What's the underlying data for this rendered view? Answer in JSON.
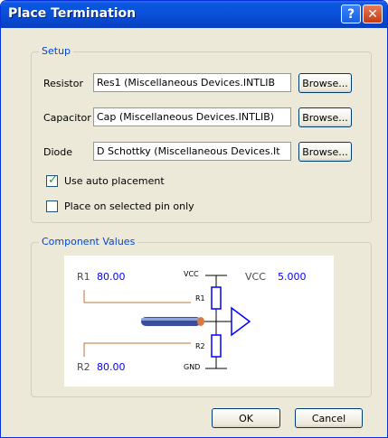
{
  "window": {
    "title": "Place Termination",
    "help_glyph": "?",
    "close_glyph": "✕"
  },
  "setup": {
    "group_label": "Setup",
    "resistor": {
      "label": "Resistor",
      "value": "Res1 (Miscellaneous Devices.INTLIB"
    },
    "capacitor": {
      "label": "Capacitor",
      "value": "Cap (Miscellaneous Devices.INTLIB)"
    },
    "diode": {
      "label": "Diode",
      "value": "D Schottky (Miscellaneous Devices.It"
    },
    "browse_label": "Browse...",
    "auto_placement": {
      "label": "Use auto placement",
      "checked": true
    },
    "selected_pin": {
      "label": "Place on selected pin only",
      "checked": false
    }
  },
  "component_values": {
    "group_label": "Component Values",
    "r1_label": "R1",
    "r1_value": "80.00",
    "r2_label": "R2",
    "r2_value": "80.00",
    "vcc_label": "VCC",
    "vcc_value": "5.000",
    "schematic": {
      "vcc": "VCC",
      "gnd": "GND",
      "r1": "R1",
      "r2": "R2"
    }
  },
  "buttons": {
    "ok": "OK",
    "cancel": "Cancel"
  },
  "colors": {
    "title_bar": "#0a4fd8",
    "group_label": "#0046d5",
    "value_blue": "#0000ff",
    "lead_orange": "#c0703a"
  }
}
